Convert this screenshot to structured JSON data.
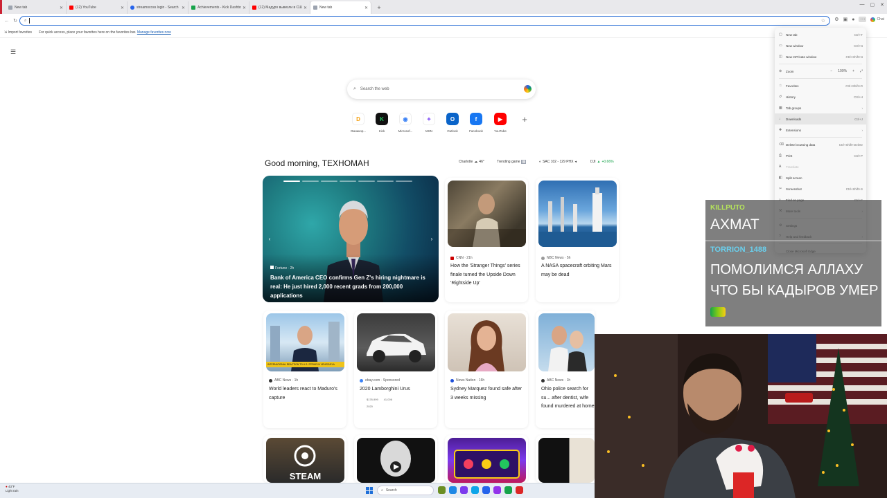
{
  "tabs": [
    {
      "title": "New tab",
      "color": "#6b7280"
    },
    {
      "title": "(12) YouTube",
      "color": "#ff0000"
    },
    {
      "title": "streamocoss login - Search",
      "color": "#2563eb"
    },
    {
      "title": "Achievements - Kick Dashboard",
      "color": "#16a34a"
    },
    {
      "title": "(12) Мадуро вывезли в США. Бра...",
      "color": "#ff0000"
    },
    {
      "title": "New tab",
      "color": "#6b7280"
    }
  ],
  "address": {
    "placeholder": ""
  },
  "toolbar": {
    "chat_label": "Chat"
  },
  "favorites_bar": {
    "import_label": "Import favorites",
    "hint": "For quick access, place your favorites here on the favorites bar.",
    "manage_link": "Manage favorites now"
  },
  "search": {
    "placeholder": "Search the web"
  },
  "quick_links": [
    {
      "label": "Омникор...",
      "color": "#f59e0b",
      "glyph": "D"
    },
    {
      "label": "Kick",
      "color": "#22c55e",
      "glyph": "K"
    },
    {
      "label": "Microsof...",
      "color": "#3b82f6",
      "glyph": "◉"
    },
    {
      "label": "MSN",
      "color": "#8b5cf6",
      "glyph": "✦"
    },
    {
      "label": "Outlook",
      "color": "#0a64c9",
      "glyph": "O"
    },
    {
      "label": "Facebook",
      "color": "#1877f2",
      "glyph": "f"
    },
    {
      "label": "YouTube",
      "color": "#ff0000",
      "glyph": "▶"
    }
  ],
  "greeting": "Good morning, ТЕХНОМАН",
  "ticker": {
    "weather": "Charlotte",
    "temp": "46°",
    "trending": "Trending game",
    "score": "SAC 102 - 129 PHX",
    "index": "DJI",
    "index_change": "+0.66%"
  },
  "hero": {
    "source": "Fortune · 2h",
    "headline": "Bank of America CEO confirms Gen Z's hiring nightmare is real: He just hired 2,000 recent grads from 200,000 applications"
  },
  "cards": [
    {
      "source": "CNN · 21h",
      "headline": "How the 'Stranger Things' series finale turned the Upside Down 'Rightside Up'",
      "dot": "#c00"
    },
    {
      "source": "NBC News · 5h",
      "headline": "A NASA spacecraft orbiting Mars may be dead",
      "dot": "#999"
    },
    {
      "source": "ABC News · 1h",
      "headline": "World leaders react to Maduro's capture",
      "dot": "#333",
      "caption": "INTERNATIONAL REACTION TO U.S. STRIKE IN VENEZUELA"
    },
    {
      "source": "ebay.com · Sponsored",
      "headline": "2020 Lamborghini Urus",
      "dot": "#3b82f6",
      "meta1": "$176,999",
      "meta2": "41,006",
      "meta3": "2020"
    },
    {
      "source": "News Nation · 16h",
      "headline": "Sydney Marquez found safe after 3 weeks missing",
      "dot": "#1d4ed8"
    },
    {
      "source": "ABC News · 1h",
      "headline": "Ohio police search for su... after dentist, wife found murdered at home",
      "dot": "#333"
    }
  ],
  "bottom_cards": [
    {
      "label": "STEAM"
    }
  ],
  "menu": {
    "items": [
      {
        "label": "New tab",
        "shortcut": "Ctrl+T",
        "icon": "▢"
      },
      {
        "label": "New window",
        "shortcut": "Ctrl+N",
        "icon": "▭"
      },
      {
        "label": "New InPrivate window",
        "shortcut": "Ctrl+Shift+N",
        "icon": "◫"
      },
      {
        "label": "Zoom",
        "shortcut": "",
        "icon": "⊕"
      },
      {
        "label": "Favorites",
        "shortcut": "Ctrl+Shift+O",
        "icon": "☆"
      },
      {
        "label": "History",
        "shortcut": "Ctrl+H",
        "icon": "↺"
      },
      {
        "label": "Tab groups",
        "shortcut": "›",
        "icon": "▦"
      },
      {
        "label": "Downloads",
        "shortcut": "Ctrl+J",
        "icon": "↓"
      },
      {
        "label": "Extensions",
        "shortcut": "›",
        "icon": "✚"
      },
      {
        "label": "Delete browsing data",
        "shortcut": "Ctrl+Shift+Delete",
        "icon": "🗑"
      },
      {
        "label": "Print",
        "shortcut": "Ctrl+P",
        "icon": "⎙"
      },
      {
        "label": "Translate",
        "shortcut": "",
        "icon": "A"
      },
      {
        "label": "Split screen",
        "shortcut": "",
        "icon": "◧"
      },
      {
        "label": "Screenshot",
        "shortcut": "Ctrl+Shift+S",
        "icon": "✂"
      },
      {
        "label": "Find on page",
        "shortcut": "Ctrl+F",
        "icon": "⌕"
      },
      {
        "label": "More tools",
        "shortcut": "›",
        "icon": "⚒"
      },
      {
        "label": "Settings",
        "shortcut": "",
        "icon": "⚙"
      },
      {
        "label": "Help and feedback",
        "shortcut": "›",
        "icon": "?"
      },
      {
        "label": "Close Microsoft Edge",
        "shortcut": "",
        "icon": ""
      }
    ],
    "zoom_value": "100%"
  },
  "chat": {
    "user1": "KILLPUTO",
    "msg1": "АХМАТ",
    "user2": "TORRION_1488",
    "msg2": "ПОМОЛИМСЯ АЛЛАХУ ЧТО БЫ КАДЫРОВ УМЕР"
  },
  "taskbar": {
    "temp": "43°F",
    "weather": "Light rain",
    "search_placeholder": "Search"
  }
}
